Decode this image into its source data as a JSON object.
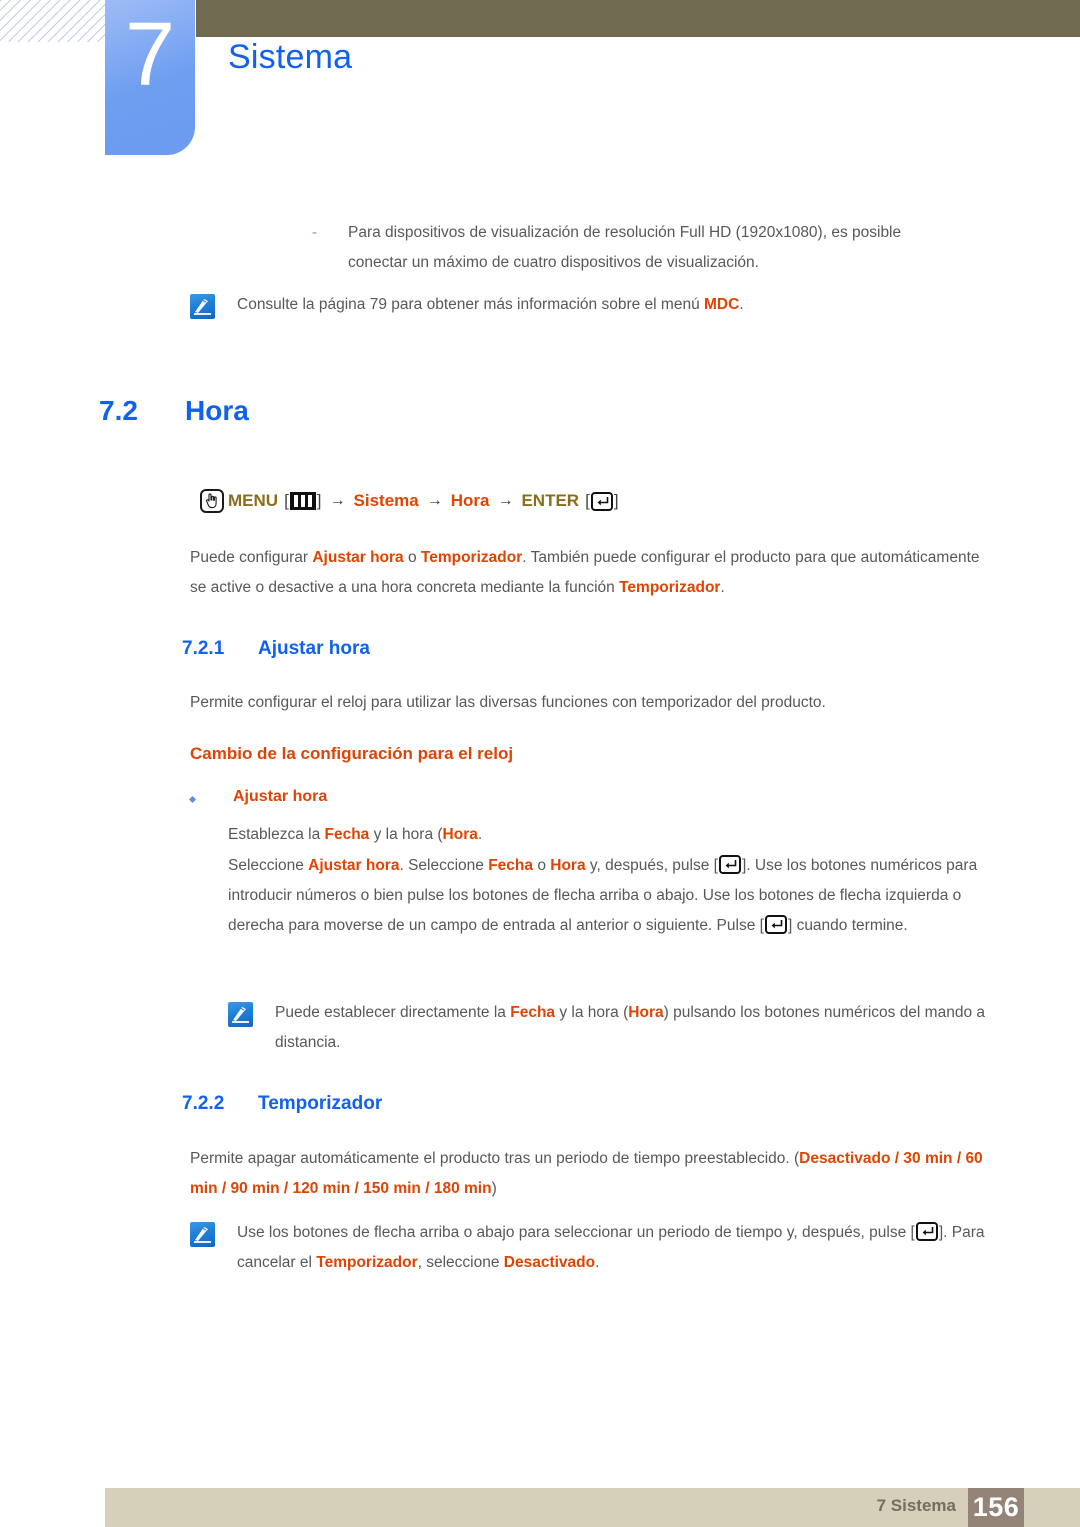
{
  "header": {
    "chapter_number": "7",
    "chapter_title": "Sistema"
  },
  "intro": {
    "dash_bullet": "-",
    "dash_text": "Para dispositivos de visualización de resolución Full HD (1920x1080), es posible conectar un máximo de cuatro dispositivos de visualización.",
    "note_1_part1": "Consulte la página 79 para obtener más información sobre el menú ",
    "note_1_keyword": "MDC",
    "note_1_part2": "."
  },
  "section": {
    "number": "7.2",
    "title": "Hora",
    "menu_path": {
      "menu_label": "MENU",
      "menu_key_icon": "menu-bars-icon",
      "bracket_open": "[",
      "bracket_close": "]",
      "arrow": "→",
      "item_1": "Sistema",
      "item_2": "Hora",
      "enter_label": "ENTER",
      "enter_key_icon": "enter-key-icon"
    },
    "paragraph_part1": "Puede configurar ",
    "paragraph_kw1": "Ajustar hora",
    "paragraph_part2": " o ",
    "paragraph_kw2": "Temporizador",
    "paragraph_part3": ". También puede configurar el producto para que automáticamente se active o desactive a una hora concreta mediante la función ",
    "paragraph_kw3": "Temporizador",
    "paragraph_part4": "."
  },
  "subsection_1": {
    "number": "7.2.1",
    "title": "Ajustar hora",
    "description": "Permite configurar el reloj para utilizar las diversas funciones con temporizador del producto.",
    "heading_red": "Cambio de la configuración para el reloj",
    "bullet_label": "Ajustar hora",
    "body_1_part1": "Establezca la ",
    "body_1_kw1": "Fecha",
    "body_1_part2": " y la hora (",
    "body_1_kw2": "Hora",
    "body_1_part3": ".",
    "body_2_part1": "Seleccione ",
    "body_2_kw1": "Ajustar hora",
    "body_2_part2": ". Seleccione ",
    "body_2_kw2": "Fecha",
    "body_2_part3": " o ",
    "body_2_kw3": "Hora",
    "body_2_part4": " y, después, pulse [",
    "body_2_part5": "]. Use los botones numéricos para introducir números o bien pulse los botones de flecha arriba o abajo. Use los botones de flecha izquierda o derecha para moverse de un campo de entrada al anterior o siguiente. Pulse [",
    "body_2_part6": "] cuando termine.",
    "note_part1": "Puede establecer directamente la ",
    "note_kw1": "Fecha",
    "note_part2": " y la hora (",
    "note_kw2": "Hora",
    "note_part3": ") pulsando los botones numéricos del mando a distancia."
  },
  "subsection_2": {
    "number": "7.2.2",
    "title": "Temporizador",
    "description_part1": "Permite apagar automáticamente el producto tras un periodo de tiempo preestablecido. (",
    "option_off": "Desactivado",
    "sep": " / ",
    "option_30": "30 min",
    "option_60": "60 min",
    "option_90": "90 min",
    "option_120": "120 min",
    "option_150": "150 min",
    "option_180": "180 min",
    "description_part2": ")",
    "note_part1": "Use los botones de flecha arriba o abajo para seleccionar un periodo de tiempo y, después, pulse [",
    "note_part2": "]. Para cancelar el ",
    "note_kw1": "Temporizador",
    "note_part3": ", seleccione ",
    "note_kw2": "Desactivado",
    "note_part4": "."
  },
  "footer": {
    "label": "7 Sistema",
    "page_number": "156"
  },
  "colors": {
    "accent_blue": "#1161f0",
    "keyword_orange": "#e04403",
    "menu_olive": "#8a6e1a",
    "header_bar": "#706a51",
    "footer_bar": "#d6d0bb",
    "footer_page_box": "#938477"
  }
}
